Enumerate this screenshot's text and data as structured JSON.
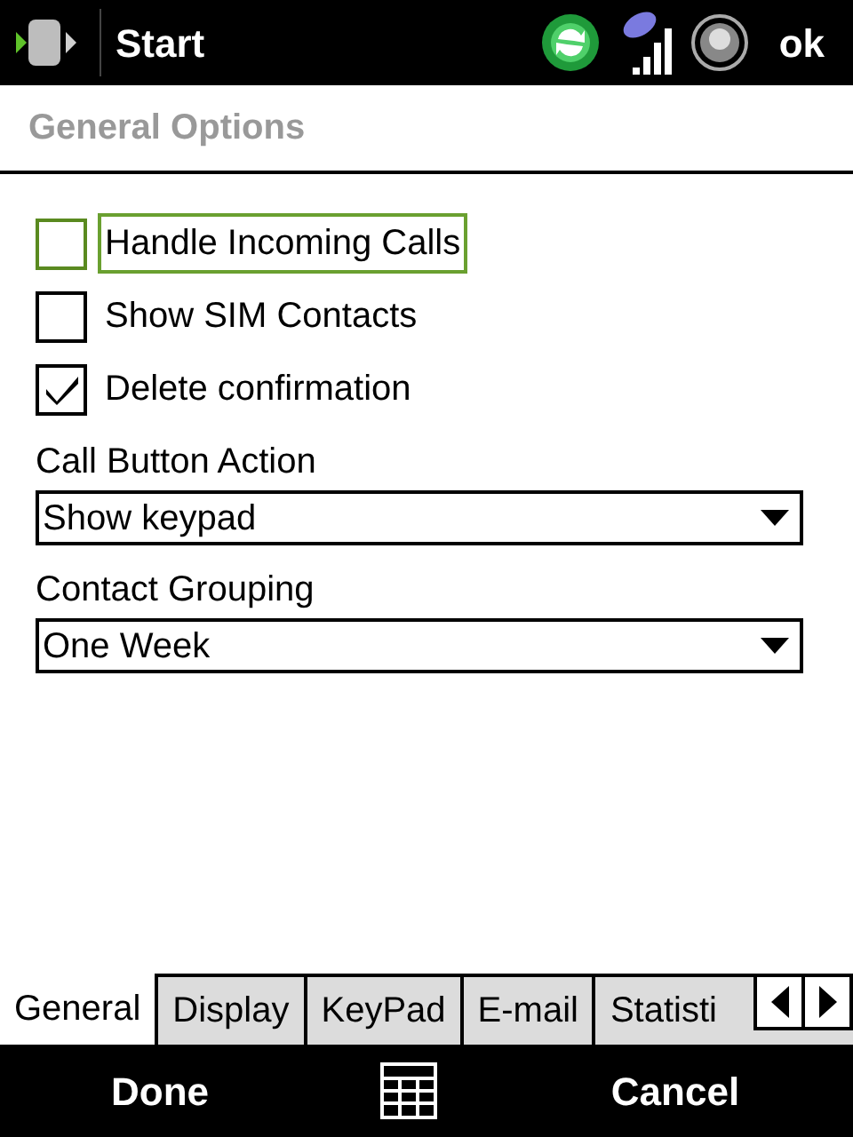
{
  "title_bar": {
    "start": "Start",
    "ok": "ok"
  },
  "header": "General Options",
  "checkboxes": [
    {
      "label": "Handle Incoming Calls",
      "checked": false,
      "focused": true
    },
    {
      "label": "Show SIM Contacts",
      "checked": false,
      "focused": false
    },
    {
      "label": "Delete confirmation",
      "checked": true,
      "focused": false
    }
  ],
  "dropdowns": [
    {
      "label": "Call Button Action",
      "value": "Show keypad"
    },
    {
      "label": "Contact Grouping",
      "value": "One Week"
    }
  ],
  "tabs": [
    {
      "label": "General",
      "selected": true
    },
    {
      "label": "Display",
      "selected": false
    },
    {
      "label": "KeyPad",
      "selected": false
    },
    {
      "label": "E-mail",
      "selected": false
    },
    {
      "label": "Statisti",
      "selected": false
    }
  ],
  "softkeys": {
    "left": "Done",
    "right": "Cancel"
  }
}
